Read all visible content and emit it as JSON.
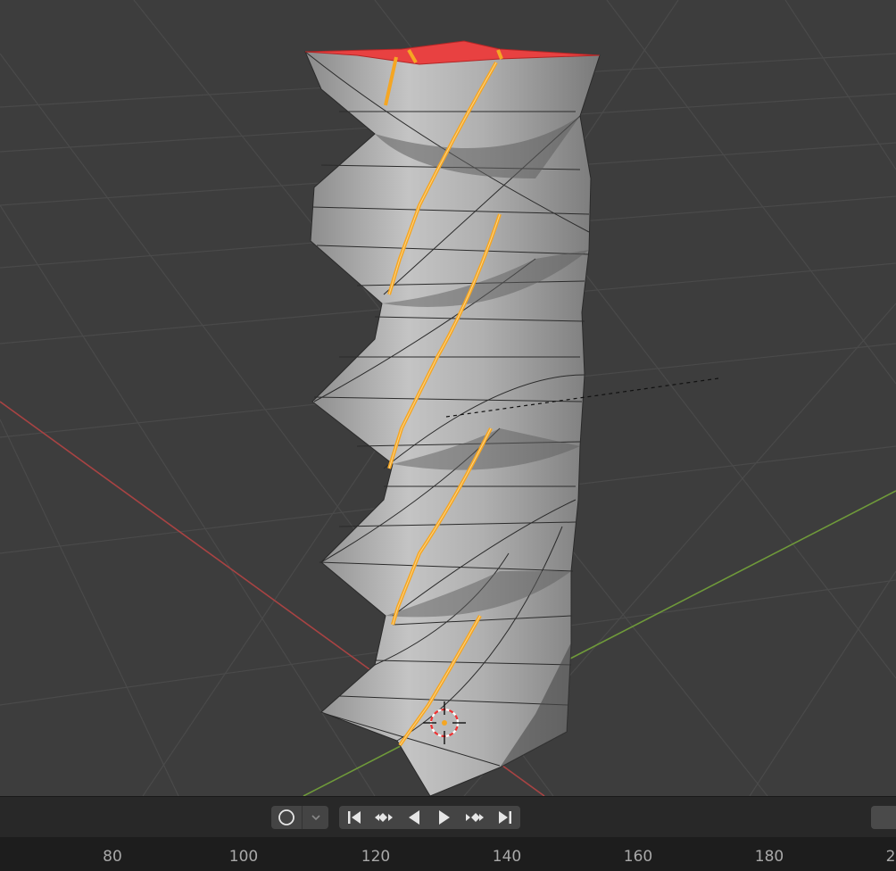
{
  "viewport": {
    "object": "twisted-column-mesh",
    "top_face_color": "#e84141",
    "selected_edge_color": "#f5a623",
    "mesh_color": "#a8a8a8",
    "x_axis_color": "#a84343",
    "y_axis_color": "#6f9a3a",
    "grid_color": "#4a4a4a"
  },
  "timeline": {
    "keying_icon": "record-circle-icon",
    "keying_dropdown_icon": "chevron-down-icon",
    "playback_icons": [
      "jump-to-start-icon",
      "prev-keyframe-icon",
      "play-reverse-icon",
      "play-icon",
      "next-keyframe-icon",
      "jump-to-end-icon"
    ]
  },
  "ruler": {
    "ticks": [
      "80",
      "100",
      "120",
      "140",
      "160",
      "180",
      "2"
    ]
  }
}
